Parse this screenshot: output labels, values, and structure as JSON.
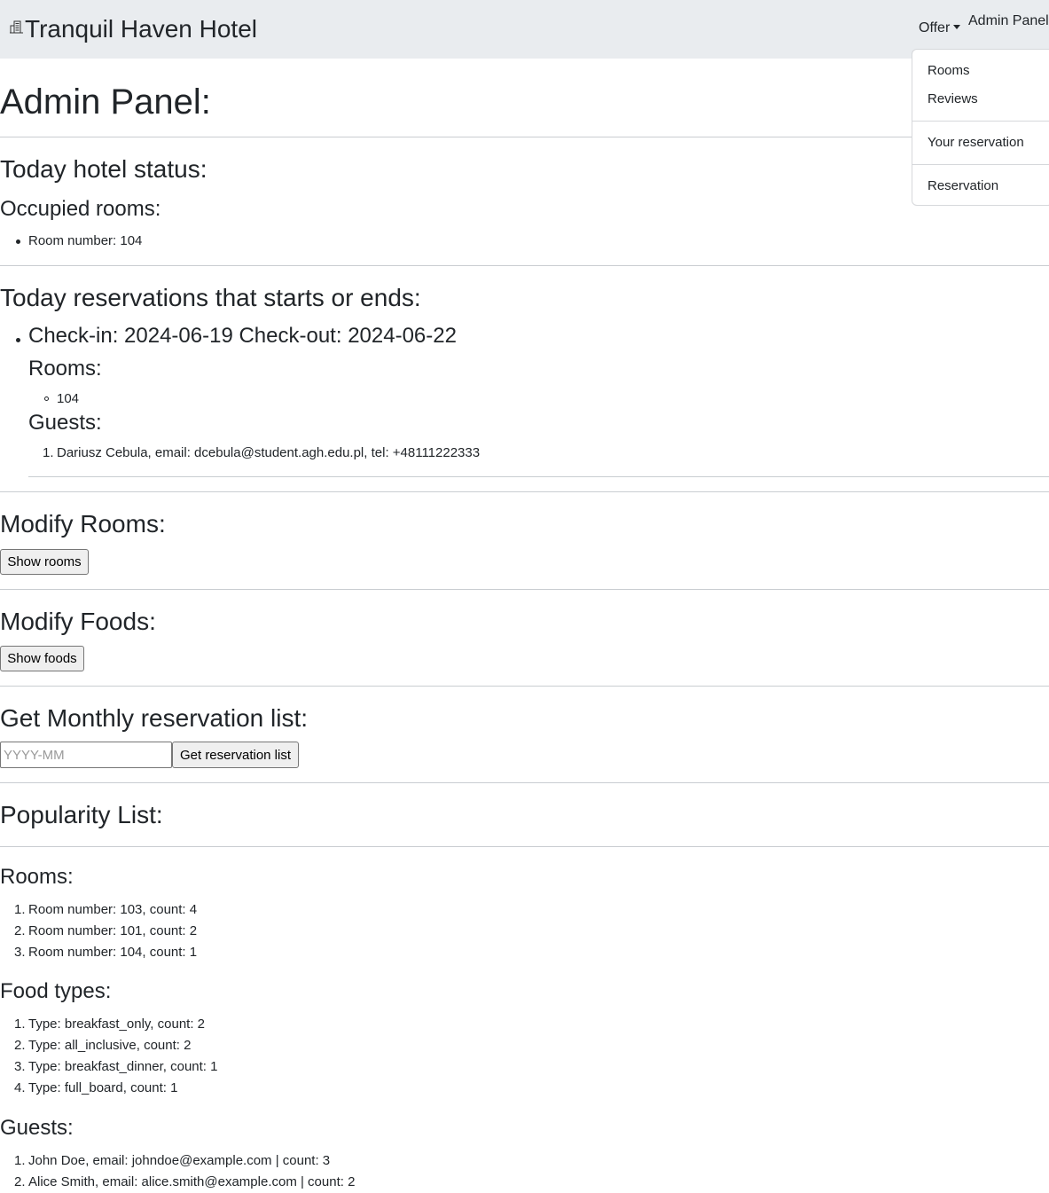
{
  "navbar": {
    "brand": "Tranquil Haven Hotel",
    "brand_icon": "building-icon",
    "offer_label": "Offer",
    "admin_label": "Admin Panel"
  },
  "dropdown": {
    "items": [
      "Rooms",
      "Reviews",
      "Your reservation",
      "Reservation"
    ]
  },
  "page": {
    "title": "Admin Panel:"
  },
  "status": {
    "heading": "Today hotel status:",
    "occupied_heading": "Occupied rooms:",
    "occupied": [
      "Room number: 104"
    ]
  },
  "today_reservations": {
    "heading": "Today reservations that starts or ends:",
    "items": [
      {
        "dates": "Check-in: 2024-06-19 Check-out: 2024-06-22",
        "rooms_heading": "Rooms:",
        "rooms": [
          "104"
        ],
        "guests_heading": "Guests:",
        "guests": [
          "Dariusz Cebula, email: dcebula@student.agh.edu.pl, tel: +48111222333"
        ]
      }
    ]
  },
  "modify_rooms": {
    "heading": "Modify Rooms:",
    "button": "Show rooms"
  },
  "modify_foods": {
    "heading": "Modify Foods:",
    "button": "Show foods"
  },
  "monthly": {
    "heading": "Get Monthly reservation list:",
    "placeholder": "YYYY-MM",
    "value": "",
    "button": "Get reservation list"
  },
  "popularity": {
    "heading": "Popularity List:",
    "rooms_heading": "Rooms:",
    "rooms": [
      "Room number: 103, count: 4",
      "Room number: 101, count: 2",
      "Room number: 104, count: 1"
    ],
    "food_heading": "Food types:",
    "foods": [
      "Type: breakfast_only, count: 2",
      "Type: all_inclusive, count: 2",
      "Type: breakfast_dinner, count: 1",
      "Type: full_board, count: 1"
    ],
    "guests_heading": "Guests:",
    "guests": [
      "John Doe, email: johndoe@example.com | count: 3",
      "Alice Smith, email: alice.smith@example.com | count: 2"
    ]
  },
  "colors": {
    "navbar_bg": "#e9ecef",
    "text": "#212529",
    "divider": "#c9cdd1"
  }
}
